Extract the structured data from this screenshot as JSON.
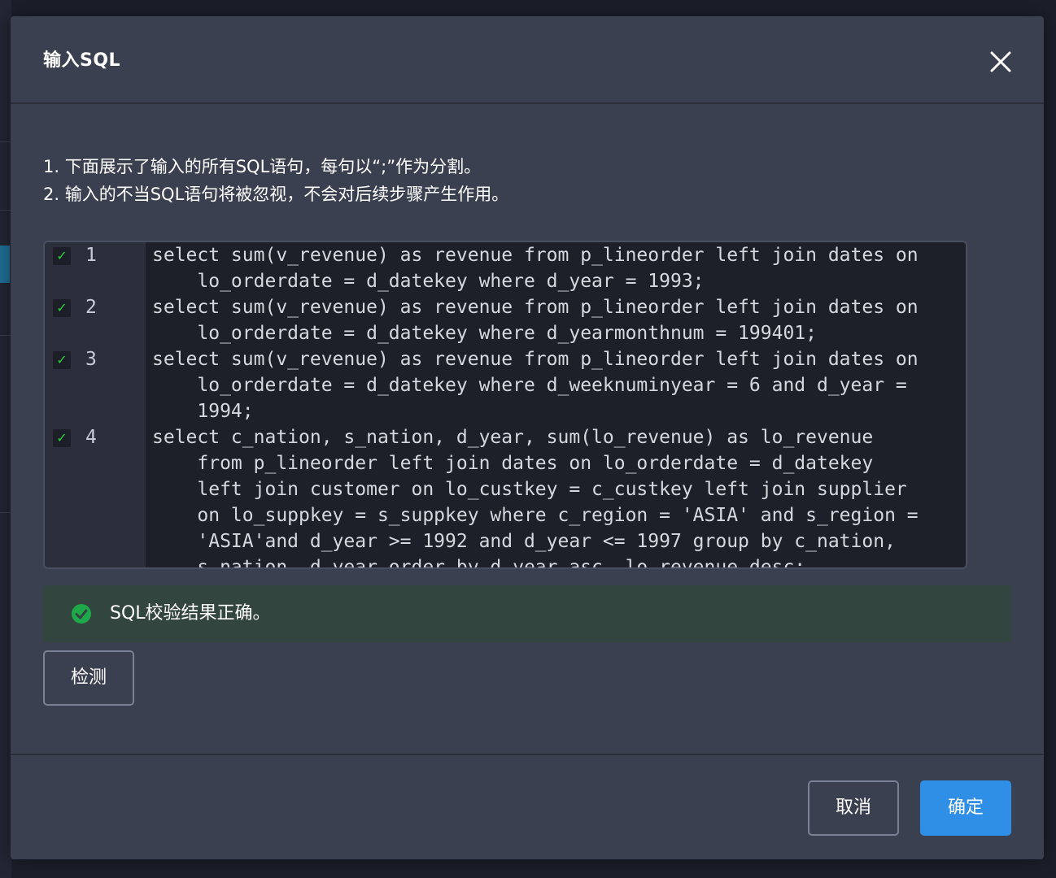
{
  "modal": {
    "title": "输入SQL",
    "close_icon": "close-icon"
  },
  "instructions": {
    "line1": "1. 下面展示了输入的所有SQL语句，每句以“;”作为分割。",
    "line2": "2. 输入的不当SQL语句将被忽视，不会对后续步骤产生作用。"
  },
  "editor": {
    "statements": [
      {
        "number": "1",
        "checked": true,
        "lines": [
          "select sum(v_revenue) as revenue from p_lineorder left join dates on",
          "    lo_orderdate = d_datekey where d_year = 1993;"
        ]
      },
      {
        "number": "2",
        "checked": true,
        "lines": [
          "select sum(v_revenue) as revenue from p_lineorder left join dates on",
          "    lo_orderdate = d_datekey where d_yearmonthnum = 199401;"
        ]
      },
      {
        "number": "3",
        "checked": true,
        "lines": [
          "select sum(v_revenue) as revenue from p_lineorder left join dates on",
          "    lo_orderdate = d_datekey where d_weeknuminyear = 6 and d_year =",
          "    1994;"
        ]
      },
      {
        "number": "4",
        "checked": true,
        "lines": [
          "select c_nation, s_nation, d_year, sum(lo_revenue) as lo_revenue",
          "    from p_lineorder left join dates on lo_orderdate = d_datekey",
          "    left join customer on lo_custkey = c_custkey left join supplier",
          "    on lo_suppkey = s_suppkey where c_region = 'ASIA' and s_region =",
          "    'ASIA'and d_year >= 1992 and d_year <= 1997 group by c_nation,",
          "    s_nation, d_year order by d_year asc, lo_revenue desc;"
        ]
      }
    ],
    "checkmark": "✓"
  },
  "result": {
    "icon": "check-circle-icon",
    "text": "SQL校验结果正确。",
    "color": "#33453f"
  },
  "buttons": {
    "check": "检测",
    "cancel": "取消",
    "confirm": "确定"
  },
  "colors": {
    "modal_bg": "#3b4050",
    "editor_bg": "#1e2029",
    "accent": "#2f8fe6",
    "success": "#1fa84a"
  }
}
